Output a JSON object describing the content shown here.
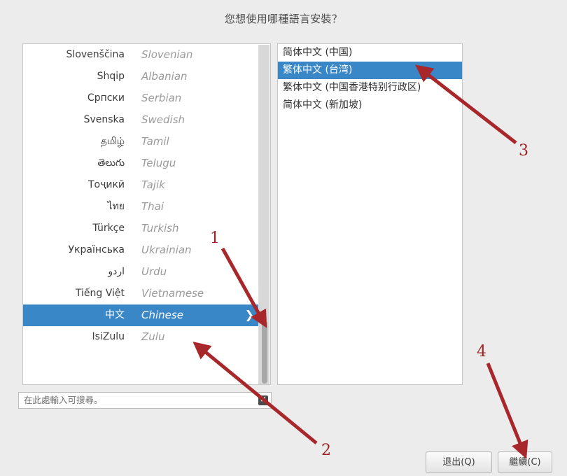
{
  "dialog": {
    "title": "您想使用哪種語言安裝？",
    "accent_blue": "#3a87c8",
    "background": "#ececed",
    "annotation_color": "#9d2224"
  },
  "language_list": {
    "items": [
      {
        "native": "Slovenščina",
        "english": "Slovenian",
        "selected": false
      },
      {
        "native": "Shqip",
        "english": "Albanian",
        "selected": false
      },
      {
        "native": "Српски",
        "english": "Serbian",
        "selected": false
      },
      {
        "native": "Svenska",
        "english": "Swedish",
        "selected": false
      },
      {
        "native": "தமிழ்",
        "english": "Tamil",
        "selected": false
      },
      {
        "native": "తెలుగు",
        "english": "Telugu",
        "selected": false
      },
      {
        "native": "Тоҷикӣ",
        "english": "Tajik",
        "selected": false
      },
      {
        "native": "ไทย",
        "english": "Thai",
        "selected": false
      },
      {
        "native": "Türkçe",
        "english": "Turkish",
        "selected": false
      },
      {
        "native": "Українська",
        "english": "Ukrainian",
        "selected": false
      },
      {
        "native": "اردو",
        "english": "Urdu",
        "selected": false
      },
      {
        "native": "Tiếng Việt",
        "english": "Vietnamese",
        "selected": false
      },
      {
        "native": "中文",
        "english": "Chinese",
        "selected": true
      },
      {
        "native": "IsiZulu",
        "english": "Zulu",
        "selected": false
      }
    ],
    "chevron_glyph": "❯"
  },
  "search": {
    "placeholder": "在此處輸入可搜尋。",
    "value": "",
    "clear_icon_glyph": "✖"
  },
  "variant_list": {
    "items": [
      {
        "label": "简体中文 (中国)",
        "selected": false
      },
      {
        "label": "繁体中文 (台湾)",
        "selected": true
      },
      {
        "label": "繁体中文 (中国香港特别行政区)",
        "selected": false
      },
      {
        "label": "简体中文 (新加坡)",
        "selected": false
      }
    ]
  },
  "buttons": {
    "quit": "退出(Q)",
    "continue": "繼續(C)"
  },
  "annotations": {
    "marks": [
      {
        "number": "1"
      },
      {
        "number": "2"
      },
      {
        "number": "3"
      },
      {
        "number": "4"
      }
    ]
  }
}
